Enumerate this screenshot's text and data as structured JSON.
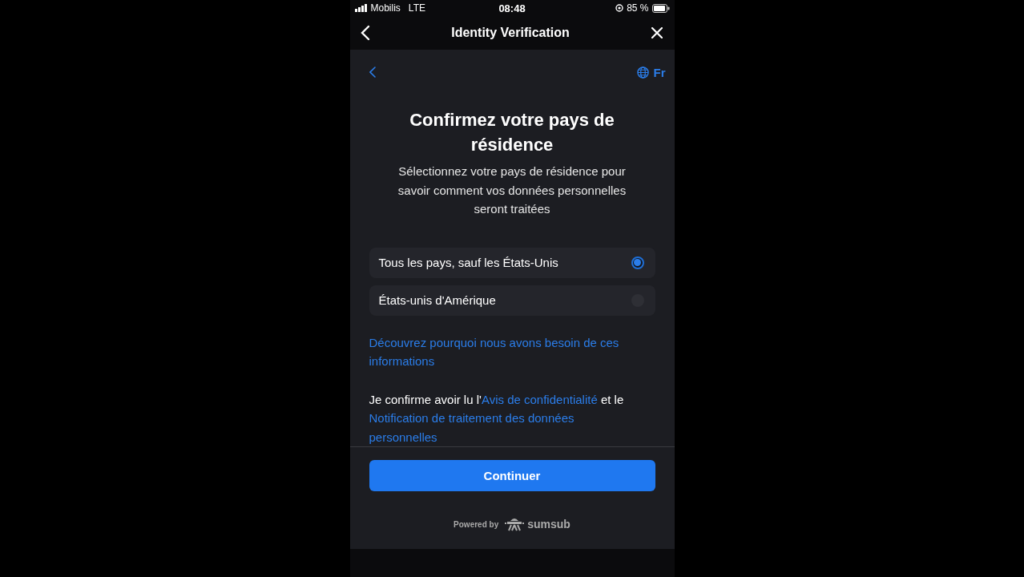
{
  "status_bar": {
    "carrier": "Mobilis",
    "network": "LTE",
    "time": "08:48",
    "battery": "85 %"
  },
  "header": {
    "title": "Identity Verification"
  },
  "toolbar": {
    "language": "Fr"
  },
  "title": "Confirmez votre pays de résidence",
  "subtitle": "Sélectionnez votre pays de résidence pour savoir comment vos données personnelles seront traitées",
  "options": [
    {
      "label": "Tous les pays, sauf les États-Unis",
      "selected": true
    },
    {
      "label": "États-unis d'Amérique",
      "selected": false
    }
  ],
  "learn_more_link": "Découvrez pourquoi nous avons besoin de ces informations",
  "consent": [
    {
      "kind": "text",
      "text": "Je confirme avoir lu l'"
    },
    {
      "kind": "link",
      "text": "Avis de confidentialité"
    },
    {
      "kind": "text",
      "text": " et le "
    },
    {
      "kind": "link",
      "text": "Notification de traitement des données personnelles"
    }
  ],
  "button": "Continuer",
  "footer": {
    "powered_by": "Powered by",
    "brand": "sumsub"
  }
}
